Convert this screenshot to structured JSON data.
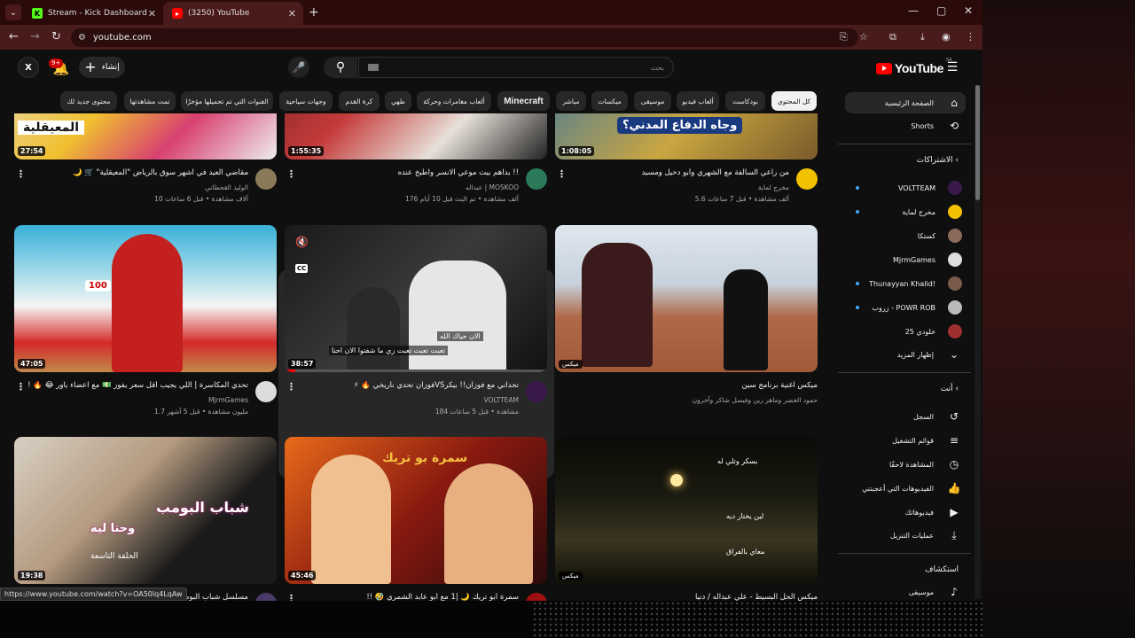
{
  "browser": {
    "tabs": [
      {
        "title": "Stream - Kick Dashboard",
        "favicon": "K"
      },
      {
        "title": "(3250) YouTube",
        "favicon": "yt"
      }
    ],
    "url": "youtube.com",
    "status_url": "https://www.youtube.com/watch?v=OA50lq4LqAw"
  },
  "header": {
    "avatar_text": "X",
    "notification_count": "9+",
    "create_label": "إنشاء",
    "search_placeholder": "بحث",
    "logo_text": "YouTube",
    "region": "SA"
  },
  "chips": [
    "كل المحتوى",
    "بودكاست",
    "ألعاب فيديو",
    "موسيقى",
    "ميكسات",
    "مباشر",
    "Minecraft",
    "ألعاب مغامرات وحركة",
    "كرة القدم",
    "طهي",
    "وجهات سياحية",
    "الفنوات التي تم تحميلها مؤخرًا",
    "تمت مشاهدتها",
    "محتوى جديد لك"
  ],
  "videos": [
    {
      "title": "من راعي السالفة مع الشهري وأبو دخيل ومسيد",
      "channel": "مخرج لماية",
      "stats": "5.6 ألف مشاهدة • قبل 7 ساعات",
      "duration": "1:08:05",
      "thumb_text": "وجاه الدفاع المدني؟"
    },
    {
      "title": "!! بداهم بيت موعي الانسر واطبخ عنده",
      "channel": "عبداله | MOSKOO",
      "stats": "176 ألف مشاهدة • تم البث قبل 10 أيام",
      "duration": "1:55:35",
      "thumb_text": ""
    },
    {
      "title": "مقاضي العيد في اشهر سوق بالرياض \"المعيقلية\" 🛒 🌙",
      "channel": "الوليد القحطاني",
      "stats": "10 آلاف مشاهدة • قبل 6 ساعات",
      "duration": "27:54",
      "thumb_text": "المعيقلية"
    },
    {
      "title": "ميكس اغنية برنامج سين",
      "channel": "حمود الخضر وماهر زين وفيصل شاكر وآخرون",
      "stats": "",
      "duration": "ميكس",
      "thumb_text": ""
    },
    {
      "title": "تحداني مع فوزان!! بيكرVSفوزان تحدي ناريخي 🔥 ⚡",
      "channel": "VOLTTEAM",
      "stats": "184 مشاهدة • قبل 5 ساعات",
      "duration": "38:57",
      "thumb_text": "",
      "subtitle1": "الان حياك الله",
      "subtitle2": "تعبت تعبت تعبت زي ما شفتوا الان احنا",
      "cc": "CC"
    },
    {
      "title": "تحدي المكاسرة | اللي يجيب أقل سعر يفوز 💵 مع اعضاء باور 😂 🔥 !",
      "channel": "MjrmGames",
      "stats": "1.7 مليون مشاهدة • قبل 5 أشهر",
      "duration": "47:05",
      "thumb_text": "100"
    },
    {
      "title": "ميكس الحل البسيط - علي عبداله / دنيا",
      "channel": "",
      "stats": "",
      "duration": "ميكس",
      "thumb_text": "",
      "subtitle1": "بسكر وتلي له",
      "subtitle2": "لين يختار ديه",
      "subtitle3": "معاي بالفراق"
    },
    {
      "title": "سمرة أبو تريك 🌙 |1 مع أبو عابد الشمري 🤣 !!",
      "channel": "",
      "stats": "",
      "duration": "45:46",
      "thumb_text": "سمرة بو تريك"
    },
    {
      "title": "مسلسل شباب البومب 5 - الحلقة",
      "channel": "",
      "stats": "",
      "duration": "19:38",
      "thumb_text": "شباب البومب",
      "thumb_text2": "وحنا ليه",
      "thumb_text3": "الحلقة التاسعة"
    }
  ],
  "sidebar": {
    "home": "الصفحة الرئيسية",
    "shorts": "Shorts",
    "subscriptions_header": "الاشتراكات",
    "subscriptions": [
      "VOLTTEAM",
      "مخرج لماية",
      "كستكا",
      "MjrmGames",
      "Thunayyan Khalid!",
      "زروب - POWR ROB",
      "خلودي 25"
    ],
    "show_more": "إظهار المزيد",
    "you_header": "أنت",
    "you_items": [
      "السجل",
      "قوائم التشغيل",
      "المشاهدة لاحقًا",
      "الفيديوهات التي أعجبتني",
      "فيديوهاتك",
      "عمليات التنزيل"
    ],
    "explore_header": "استكشاف",
    "explore_items": [
      "موسيقى"
    ]
  },
  "colors": {
    "brand": "#ff0000",
    "bg": "#0f0f0f",
    "chrome": "#4a1b1b"
  }
}
